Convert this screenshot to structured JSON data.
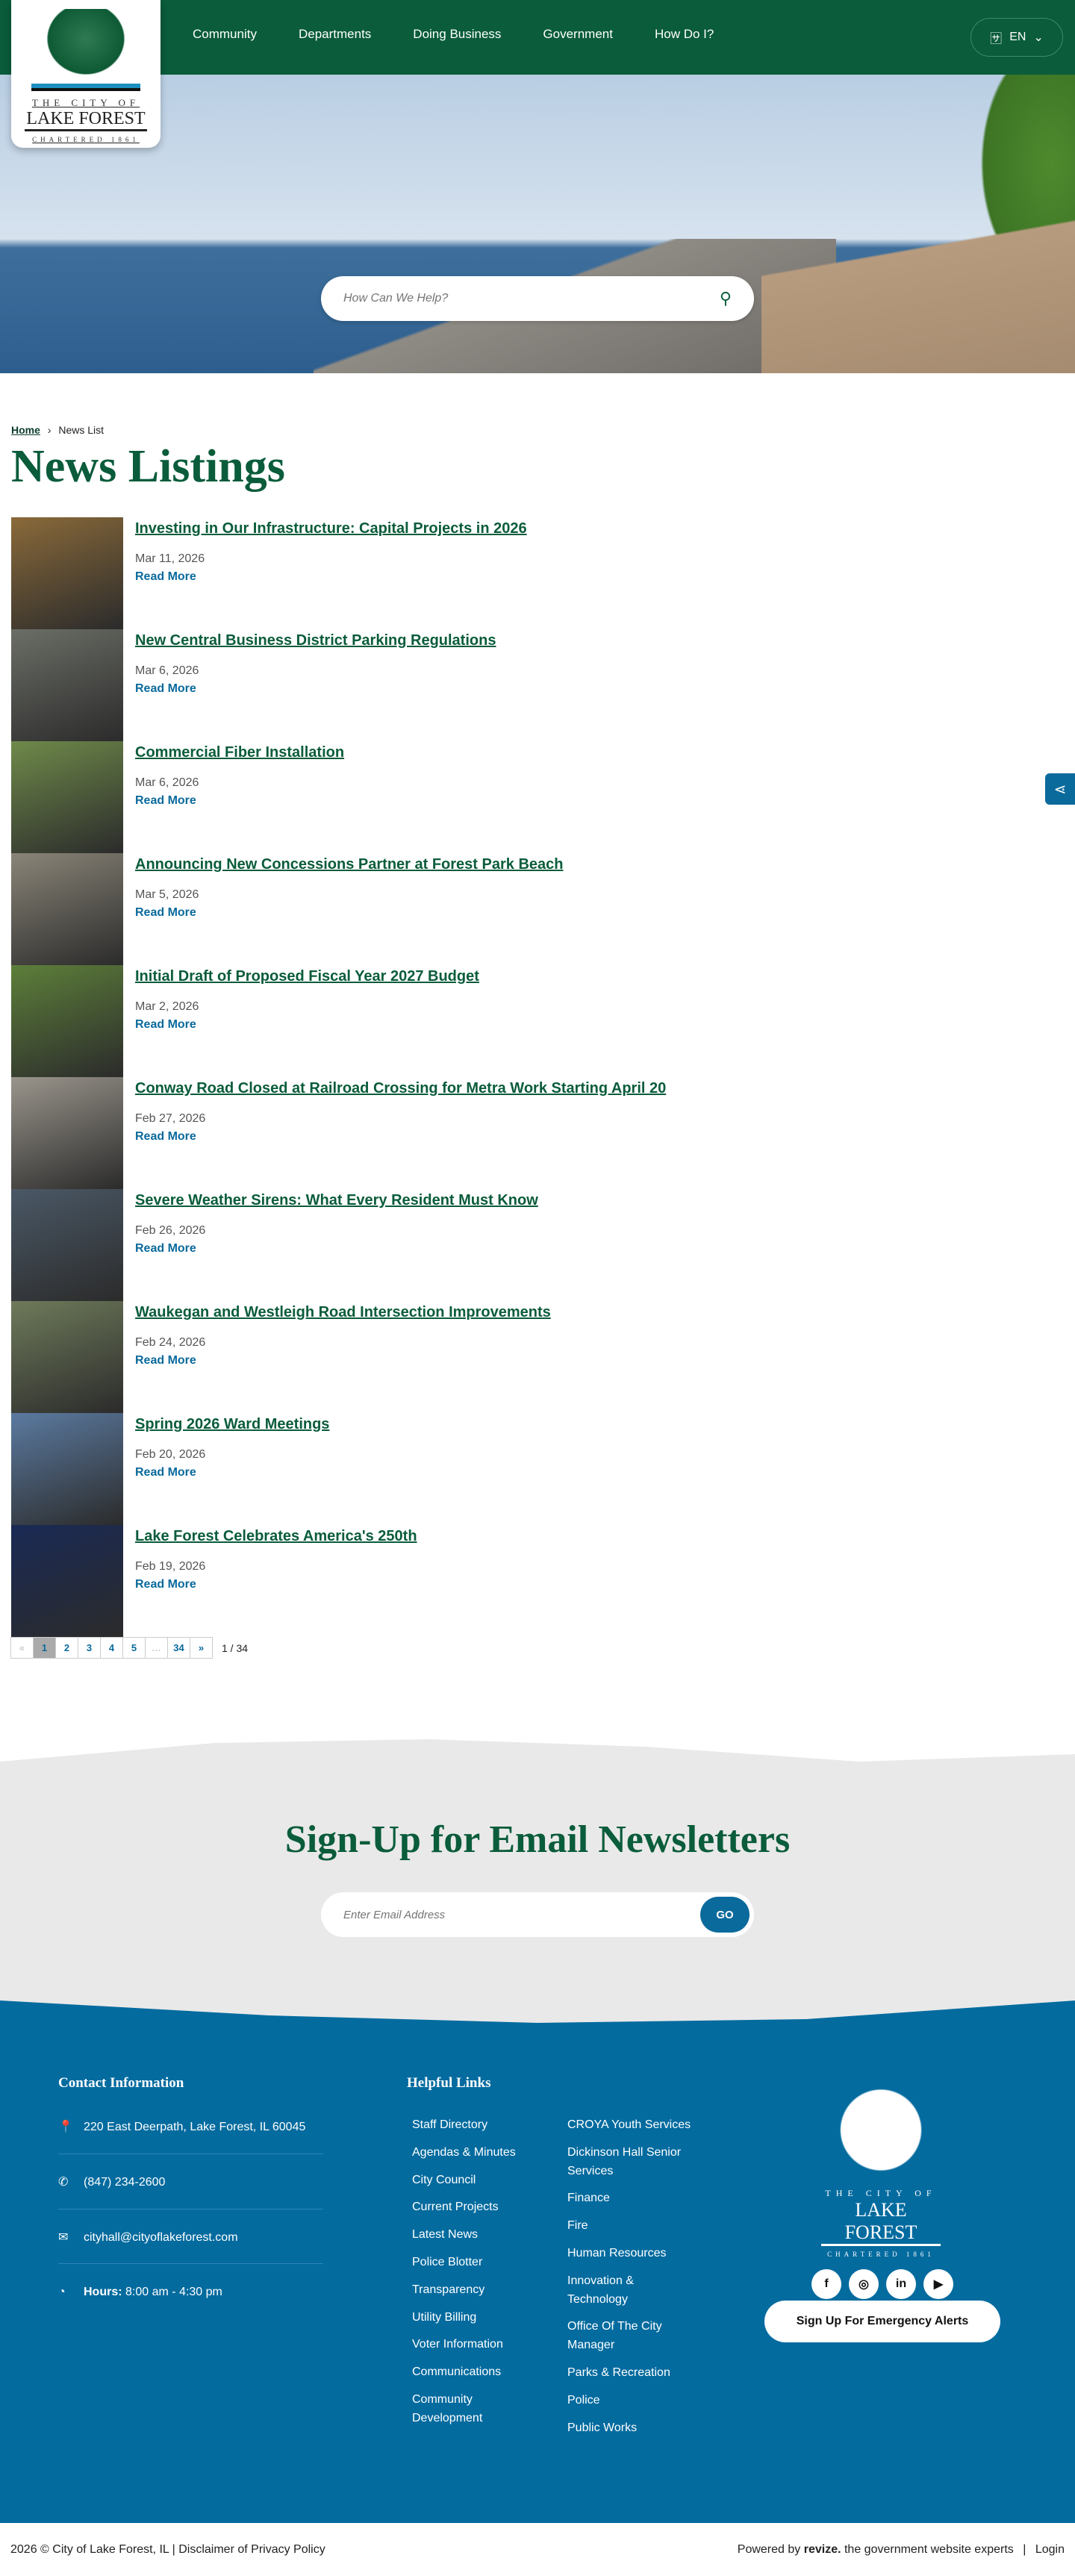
{
  "header": {
    "logo": {
      "line1": "THE CITY OF",
      "line2": "LAKE FOREST",
      "line3": "CHARTERED 1861"
    },
    "nav": [
      "Community",
      "Departments",
      "Doing Business",
      "Government",
      "How Do I?"
    ],
    "language": "EN"
  },
  "hero": {
    "search_placeholder": "How Can We Help?"
  },
  "breadcrumb": {
    "home": "Home",
    "sep": "›",
    "current": "News List"
  },
  "page_title": "News Listings",
  "read_more": "Read More",
  "news": [
    {
      "title": "Investing in Our Infrastructure: Capital Projects in 2026",
      "date": "Mar 11, 2026",
      "color": "#8a6a3a"
    },
    {
      "title": "New Central Business District Parking Regulations",
      "date": "Mar 6, 2026",
      "color": "#6b6e66"
    },
    {
      "title": "Commercial Fiber Installation",
      "date": "Mar 6, 2026",
      "color": "#6f8a4a"
    },
    {
      "title": "Announcing New Concessions Partner at Forest Park Beach",
      "date": "Mar 5, 2026",
      "color": "#8a8578"
    },
    {
      "title": "Initial Draft of Proposed Fiscal Year 2027 Budget",
      "date": "Mar 2, 2026",
      "color": "#5d7f3a"
    },
    {
      "title": "Conway Road Closed at Railroad Crossing for Metra Work Starting April 20",
      "date": "Feb 27, 2026",
      "color": "#9a958c"
    },
    {
      "title": "Severe Weather Sirens: What Every Resident Must Know",
      "date": "Feb 26, 2026",
      "color": "#4a5866"
    },
    {
      "title": "Waukegan and Westleigh Road Intersection Improvements",
      "date": "Feb 24, 2026",
      "color": "#6e7a5a"
    },
    {
      "title": "Spring 2026 Ward Meetings",
      "date": "Feb 20, 2026",
      "color": "#5b7aa0"
    },
    {
      "title": "Lake Forest Celebrates America's 250th",
      "date": "Feb 19, 2026",
      "color": "#1a2a55"
    }
  ],
  "pagination": {
    "prev": "«",
    "pages": [
      "1",
      "2",
      "3",
      "4",
      "5",
      "…",
      "34"
    ],
    "next": "»",
    "summary": "1 / 34"
  },
  "newsletter": {
    "title": "Sign-Up for Email Newsletters",
    "placeholder": "Enter Email Address",
    "button": "GO"
  },
  "footer": {
    "contact_heading": "Contact Information",
    "address": "220 East Deerpath, Lake Forest, IL 60045",
    "phone": "(847) 234-2600",
    "email": "cityhall@cityoflakeforest.com",
    "hours_label": "Hours:",
    "hours": "8:00 am - 4:30 pm",
    "links_heading": "Helpful Links",
    "links_col1": [
      "Staff Directory",
      "Agendas & Minutes",
      "City Council",
      "Current Projects",
      "Latest News",
      "Police Blotter",
      "Transparency",
      "Utility Billing",
      "Voter Information",
      "Communications",
      "Community Development"
    ],
    "links_col2": [
      "CROYA  Youth Services",
      "Dickinson Hall Senior Services",
      "Finance",
      "Fire",
      "Human Resources",
      "Innovation & Technology",
      "Office Of The City Manager",
      "Parks & Recreation",
      "Police",
      "Public Works"
    ],
    "social": {
      "facebook": "f",
      "instagram": "◎",
      "linkedin": "in",
      "youtube": "▶"
    },
    "alerts_button": "Sign Up For Emergency Alerts"
  },
  "bottom": {
    "copyright": "2026 © City of Lake Forest, IL | Disclaimer of Privacy Policy",
    "powered": "Powered by",
    "brand": "revize.",
    "tagline": "the government website experts",
    "sep": "|",
    "login": "Login"
  }
}
